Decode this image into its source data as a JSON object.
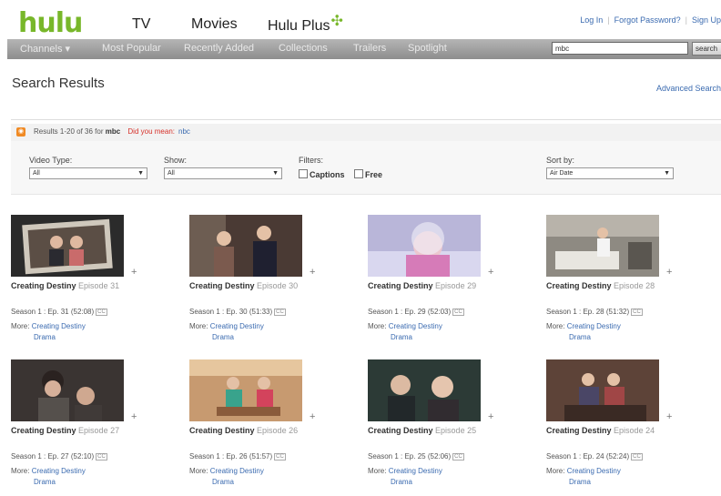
{
  "header": {
    "logo": "hulu",
    "nav": [
      {
        "label": "TV"
      },
      {
        "label": "Movies"
      },
      {
        "label": "Hulu Plus"
      }
    ],
    "links": {
      "login": "Log In",
      "forgot": "Forgot Password?",
      "signup": "Sign Up"
    }
  },
  "navbar": {
    "items": [
      "Channels ▾",
      "Most Popular",
      "Recently Added",
      "Collections",
      "Trailers",
      "Spotlight"
    ],
    "search_value": "mbc",
    "search_button": "search"
  },
  "page": {
    "title": "Search Results",
    "advanced_search": "Advanced Search"
  },
  "results": {
    "summary_prefix": "Results 1-20 of 36 for",
    "query": "mbc",
    "did_you_mean": "Did you mean:",
    "suggestion": "nbc"
  },
  "filters": {
    "video_type": {
      "label": "Video Type:",
      "value": "All"
    },
    "show": {
      "label": "Show:",
      "value": "All"
    },
    "filters_label": "Filters:",
    "captions": "Captions",
    "free": "Free",
    "sort": {
      "label": "Sort by:",
      "value": "Air Date"
    }
  },
  "cards": [
    {
      "show": "Creating Destiny",
      "episode": "Episode 31",
      "meta": "Season 1 : Ep. 31  (52:08)",
      "cc": "CC",
      "more": "More:",
      "more_link": "Creating Destiny",
      "genre": "Drama"
    },
    {
      "show": "Creating Destiny",
      "episode": "Episode 30",
      "meta": "Season 1 : Ep. 30  (51:33)",
      "cc": "CC",
      "more": "More:",
      "more_link": "Creating Destiny",
      "genre": "Drama"
    },
    {
      "show": "Creating Destiny",
      "episode": "Episode 29",
      "meta": "Season 1 : Ep. 29  (52:03)",
      "cc": "CC",
      "more": "More:",
      "more_link": "Creating Destiny",
      "genre": "Drama"
    },
    {
      "show": "Creating Destiny",
      "episode": "Episode 28",
      "meta": "Season 1 : Ep. 28  (51:32)",
      "cc": "CC",
      "more": "More:",
      "more_link": "Creating Destiny",
      "genre": "Drama"
    },
    {
      "show": "Creating Destiny",
      "episode": "Episode 27",
      "meta": "Season 1 : Ep. 27  (52:10)",
      "cc": "CC",
      "more": "More:",
      "more_link": "Creating Destiny",
      "genre": "Drama"
    },
    {
      "show": "Creating Destiny",
      "episode": "Episode 26",
      "meta": "Season 1 : Ep. 26  (51:57)",
      "cc": "CC",
      "more": "More:",
      "more_link": "Creating Destiny",
      "genre": "Drama"
    },
    {
      "show": "Creating Destiny",
      "episode": "Episode 25",
      "meta": "Season 1 : Ep. 25  (52:06)",
      "cc": "CC",
      "more": "More:",
      "more_link": "Creating Destiny",
      "genre": "Drama"
    },
    {
      "show": "Creating Destiny",
      "episode": "Episode 24",
      "meta": "Season 1 : Ep. 24  (52:24)",
      "cc": "CC",
      "more": "More:",
      "more_link": "Creating Destiny",
      "genre": "Drama"
    }
  ],
  "plus_glyph": "+"
}
